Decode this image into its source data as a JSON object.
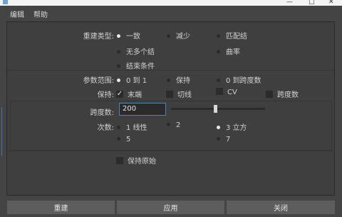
{
  "window": {
    "title": ""
  },
  "menu": [
    "编辑",
    "帮助"
  ],
  "rebuild_type": {
    "label": "重建类型:",
    "options": [
      {
        "label": "一致",
        "selected": true
      },
      {
        "label": "减少",
        "selected": false
      },
      {
        "label": "匹配结",
        "selected": false
      },
      {
        "label": "无多个结",
        "selected": false
      },
      {
        "label": "曲率",
        "selected": false
      },
      {
        "label": "结束条件",
        "selected": false
      }
    ]
  },
  "param_range": {
    "label": "参数范围:",
    "options": [
      {
        "label": "0 到 1",
        "selected": true
      },
      {
        "label": "保持",
        "selected": false
      },
      {
        "label": "0 到跨度数",
        "selected": false
      }
    ]
  },
  "keep": {
    "label": "保持:",
    "options": [
      {
        "label": "末端",
        "checked": true
      },
      {
        "label": "切线",
        "checked": false
      },
      {
        "label": "CV",
        "checked": false
      },
      {
        "label": "跨度数",
        "checked": false
      }
    ]
  },
  "spans": {
    "label": "跨度数:",
    "value": "200",
    "slider_fraction": 0.47
  },
  "degree": {
    "label": "次数:",
    "options": [
      {
        "label": "1 线性",
        "selected": false
      },
      {
        "label": "2",
        "selected": false
      },
      {
        "label": "3 立方",
        "selected": true
      },
      {
        "label": "5",
        "selected": false
      },
      {
        "label": "7",
        "selected": false
      }
    ]
  },
  "keep_original": {
    "label": "保持原始",
    "checked": false
  },
  "buttons": {
    "rebuild": "重建",
    "apply": "应用",
    "close": "关闭"
  }
}
